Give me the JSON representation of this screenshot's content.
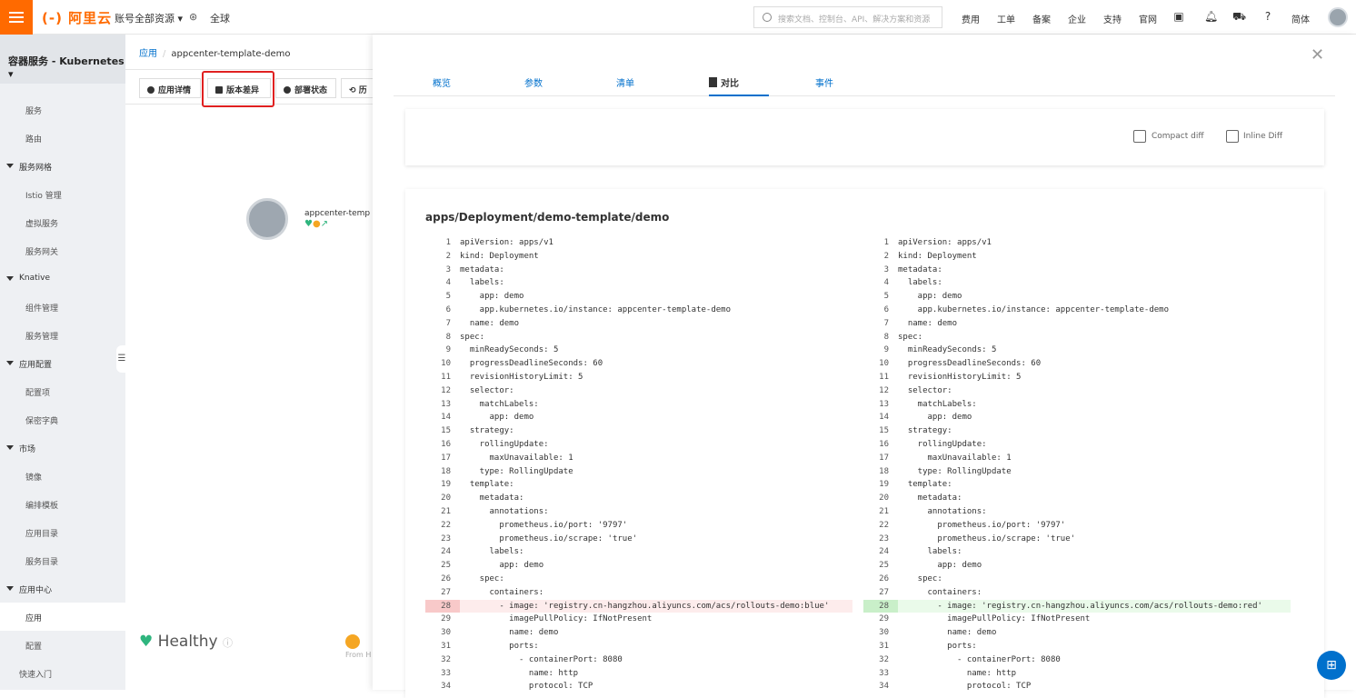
{
  "topbar": {
    "logo": "(-) 阿里云",
    "account": "账号全部资源 ▾",
    "region": "全球",
    "search_placeholder": "搜索文档、控制台、API、解决方案和资源",
    "nav": [
      "费用",
      "工单",
      "备案",
      "企业",
      "支持",
      "官网"
    ],
    "lang": "简体"
  },
  "sidebar": {
    "title": "容器服务 - Kubernetes ▾",
    "items": [
      {
        "label": "服务",
        "type": "item"
      },
      {
        "label": "路由",
        "type": "item"
      },
      {
        "label": "服务网格",
        "type": "group"
      },
      {
        "label": "Istio 管理",
        "type": "item"
      },
      {
        "label": "虚拟服务",
        "type": "item"
      },
      {
        "label": "服务网关",
        "type": "item"
      },
      {
        "label": "Knative",
        "type": "group"
      },
      {
        "label": "组件管理",
        "type": "item"
      },
      {
        "label": "服务管理",
        "type": "item"
      },
      {
        "label": "应用配置",
        "type": "group"
      },
      {
        "label": "配置项",
        "type": "item"
      },
      {
        "label": "保密字典",
        "type": "item"
      },
      {
        "label": "市场",
        "type": "group"
      },
      {
        "label": "镜像",
        "type": "item"
      },
      {
        "label": "编排模板",
        "type": "item"
      },
      {
        "label": "应用目录",
        "type": "item"
      },
      {
        "label": "服务目录",
        "type": "item"
      },
      {
        "label": "应用中心",
        "type": "group"
      },
      {
        "label": "应用",
        "type": "item",
        "active": true
      },
      {
        "label": "配置",
        "type": "item"
      },
      {
        "label": "快速入门",
        "type": "group-plain"
      }
    ]
  },
  "main": {
    "breadcrumb_root": "应用",
    "breadcrumb_current": "appcenter-template-demo",
    "tabs": [
      "应用详情",
      "版本差异",
      "部署状态",
      "历"
    ],
    "node_label": "appcenter-temp",
    "health_label": "Healthy",
    "from_label": "From H"
  },
  "drawer": {
    "tabs": [
      "概览",
      "参数",
      "清单",
      "对比",
      "事件"
    ],
    "active_tab": "对比",
    "compact_diff_label": "Compact diff",
    "inline_diff_label": "Inline Diff",
    "file_path": "apps/Deployment/demo-template/demo",
    "left_lines": [
      "apiVersion: apps/v1",
      "kind: Deployment",
      "metadata:",
      "  labels:",
      "    app: demo",
      "    app.kubernetes.io/instance: appcenter-template-demo",
      "  name: demo",
      "spec:",
      "  minReadySeconds: 5",
      "  progressDeadlineSeconds: 60",
      "  revisionHistoryLimit: 5",
      "  selector:",
      "    matchLabels:",
      "      app: demo",
      "  strategy:",
      "    rollingUpdate:",
      "      maxUnavailable: 1",
      "    type: RollingUpdate",
      "  template:",
      "    metadata:",
      "      annotations:",
      "        prometheus.io/port: '9797'",
      "        prometheus.io/scrape: 'true'",
      "      labels:",
      "        app: demo",
      "    spec:",
      "      containers:",
      "        - image: 'registry.cn-hangzhou.aliyuncs.com/acs/rollouts-demo:blue'",
      "          imagePullPolicy: IfNotPresent",
      "          name: demo",
      "          ports:",
      "            - containerPort: 8080",
      "              name: http",
      "              protocol: TCP"
    ],
    "right_lines": [
      "apiVersion: apps/v1",
      "kind: Deployment",
      "metadata:",
      "  labels:",
      "    app: demo",
      "    app.kubernetes.io/instance: appcenter-template-demo",
      "  name: demo",
      "spec:",
      "  minReadySeconds: 5",
      "  progressDeadlineSeconds: 60",
      "  revisionHistoryLimit: 5",
      "  selector:",
      "    matchLabels:",
      "      app: demo",
      "  strategy:",
      "    rollingUpdate:",
      "      maxUnavailable: 1",
      "    type: RollingUpdate",
      "  template:",
      "    metadata:",
      "      annotations:",
      "        prometheus.io/port: '9797'",
      "        prometheus.io/scrape: 'true'",
      "      labels:",
      "        app: demo",
      "    spec:",
      "      containers:",
      "        - image: 'registry.cn-hangzhou.aliyuncs.com/acs/rollouts-demo:red'",
      "          imagePullPolicy: IfNotPresent",
      "          name: demo",
      "          ports:",
      "            - containerPort: 8080",
      "              name: http",
      "              protocol: TCP"
    ],
    "changed_line": 28
  },
  "colors": {
    "brand": "#ff6a00",
    "link": "#0070cc",
    "deleted_bg": "#fdecec",
    "added_bg": "#eafaea",
    "healthy": "#2fb57e",
    "highlight_box": "#e02020"
  }
}
